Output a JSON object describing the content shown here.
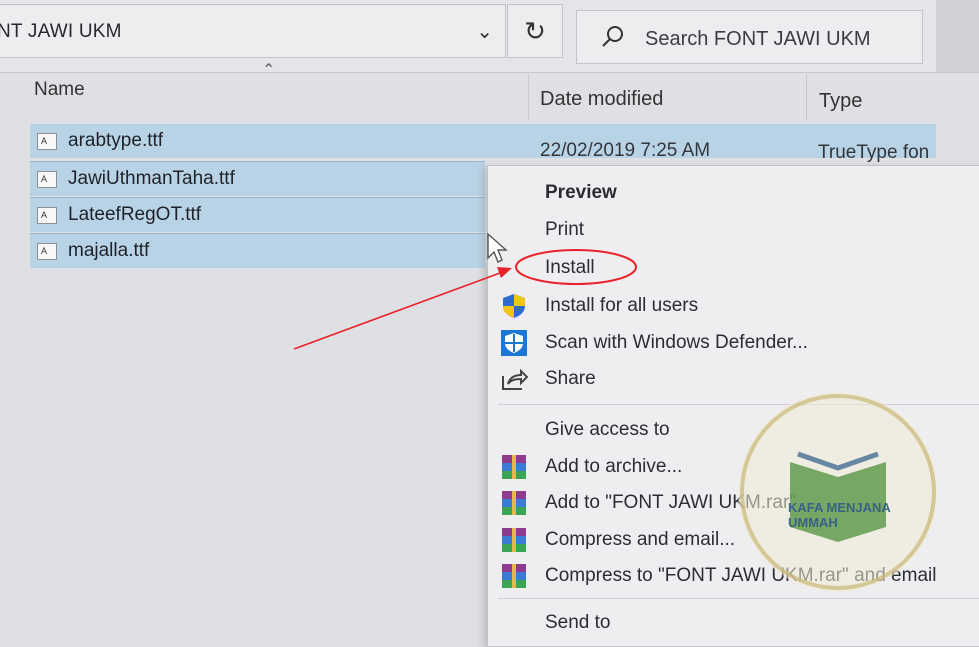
{
  "address_bar": {
    "path": "NT JAWI UKM"
  },
  "search": {
    "placeholder": "Search FONT JAWI UKM"
  },
  "columns": {
    "name": "Name",
    "date": "Date modified",
    "type": "Type"
  },
  "files": [
    {
      "name": "arabtype.ttf",
      "icon_letter": "A",
      "date": "22/02/2019 7:25 AM",
      "type": "TrueType fon"
    },
    {
      "name": "JawiUthmanTaha.ttf",
      "icon_letter": "A"
    },
    {
      "name": "LateefRegOT.ttf",
      "icon_letter": "A"
    },
    {
      "name": "majalla.ttf",
      "icon_letter": "A"
    }
  ],
  "context_menu": {
    "preview": "Preview",
    "print": "Print",
    "install": "Install",
    "install_all": "Install for all users",
    "scan": "Scan with Windows Defender...",
    "share": "Share",
    "give_access": "Give access to",
    "add_archive": "Add to archive...",
    "add_rar": "Add to \"FONT JAWI UKM.rar\"",
    "compress_email": "Compress and email...",
    "compress_rar_email": "Compress to \"FONT JAWI UKM.rar\" and email",
    "send_to": "Send to"
  },
  "watermark": {
    "text": "KAFA MENJANA UMMAH"
  },
  "colors": {
    "selection": "#b9d3e6",
    "annotation": "#e8232a",
    "menu_bg": "#eeeef0",
    "window_bg": "#dfe0e3"
  }
}
